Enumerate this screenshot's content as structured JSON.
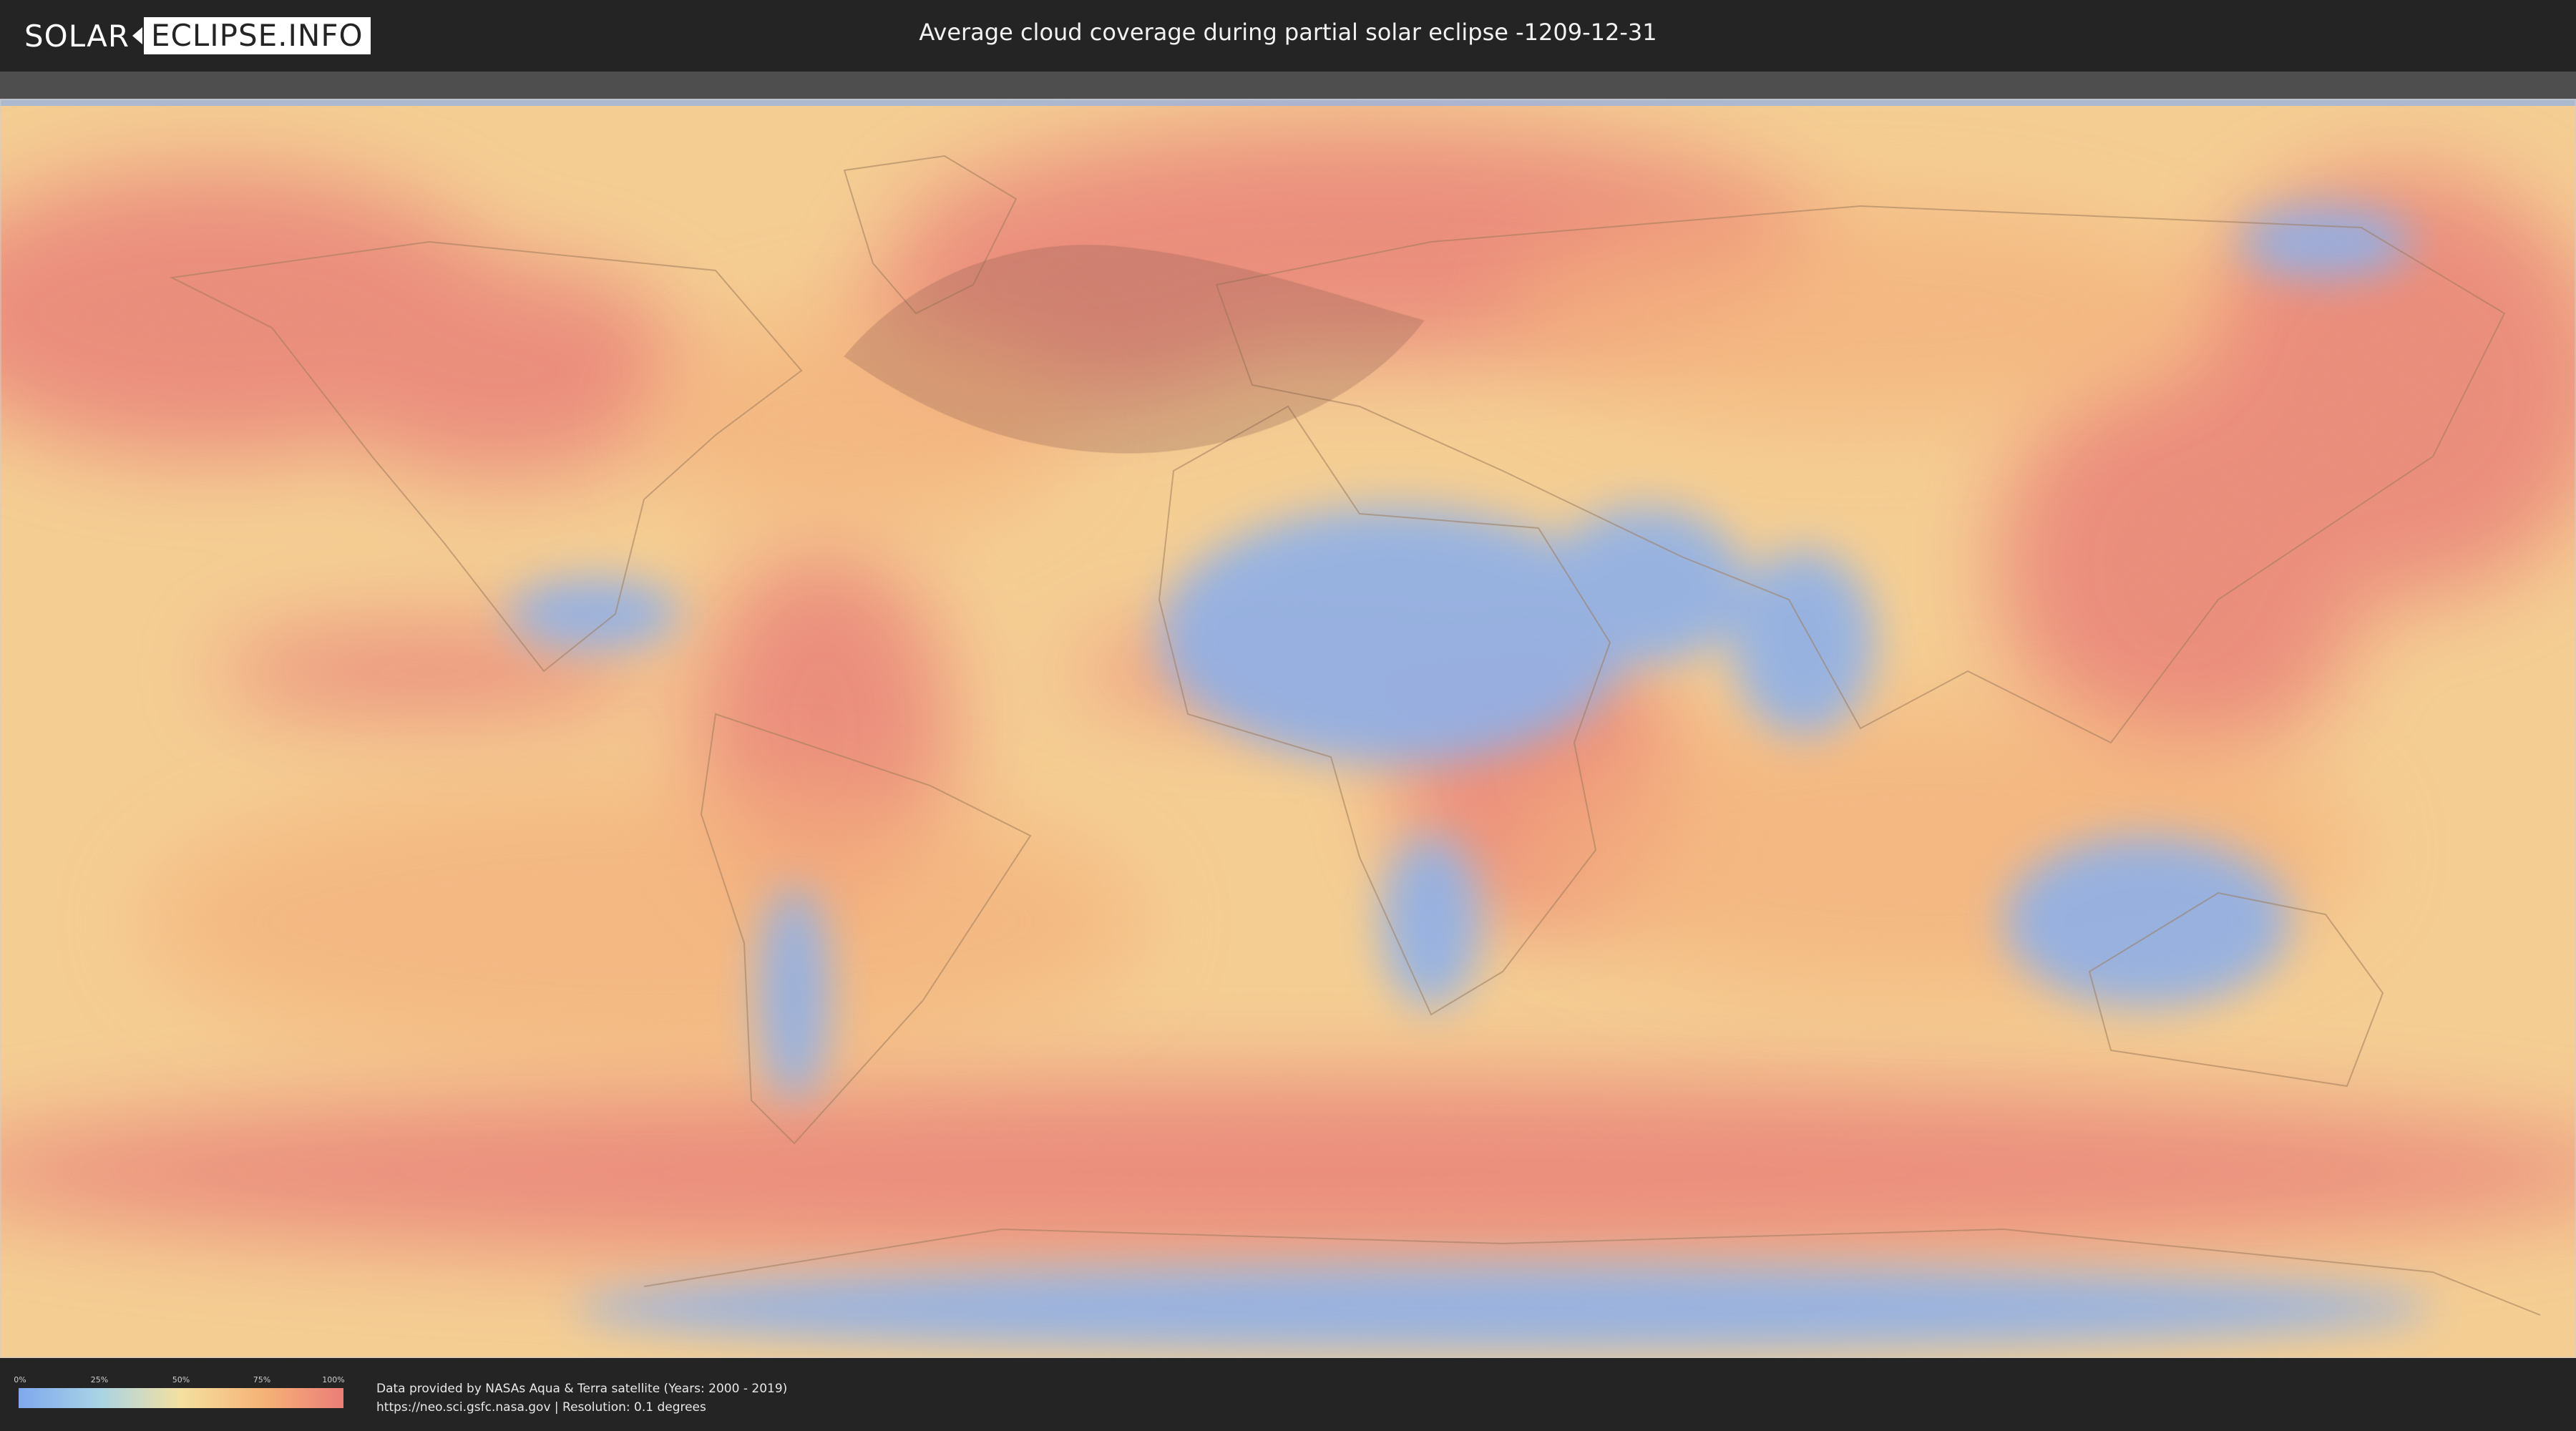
{
  "header": {
    "logo_part1": "SOLAR",
    "logo_part2": "ECLIPSE.INFO",
    "title": "Average cloud coverage during partial solar eclipse -1209-12-31"
  },
  "legend": {
    "ticks": [
      "0%",
      "25%",
      "50%",
      "75%",
      "100%"
    ],
    "tick_values": [
      0,
      25,
      50,
      75,
      100
    ],
    "colors": [
      "#7ea8ee",
      "#a9d3e4",
      "#f4e0a0",
      "#f5b377",
      "#ec7d78"
    ]
  },
  "footer": {
    "line1": "Data provided by NASAs Aqua & Terra satellite (Years: 2000 - 2019)",
    "line2": "https://neo.sci.gsfc.nasa.gov | Resolution: 0.1 degrees"
  },
  "map": {
    "projection": "equirectangular",
    "eclipse_zone_color": "#8a5a4f"
  }
}
